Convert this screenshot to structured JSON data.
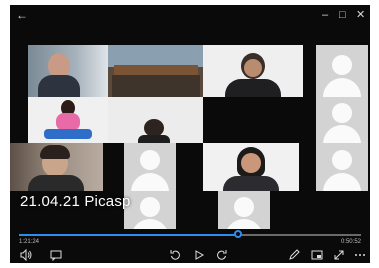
{
  "window": {
    "back_icon": "arrow-left",
    "minimize": "–",
    "maximize": "□",
    "close": "✕"
  },
  "video": {
    "title": "21.04.21 Picasp",
    "elapsed": "1:21:24",
    "remaining": "0:50:52",
    "progress": 0.64
  },
  "controls": {
    "volume_icon": "volume-icon",
    "subtitles_icon": "subtitles-icon",
    "rewind_icon": "skip-back-10-icon",
    "play_icon": "play-icon",
    "forward_icon": "skip-forward-30-icon",
    "edit_icon": "pen-icon",
    "miniview_icon": "mini-view-icon",
    "fullscreen_icon": "fullscreen-icon",
    "more_icon": "more-icon"
  }
}
